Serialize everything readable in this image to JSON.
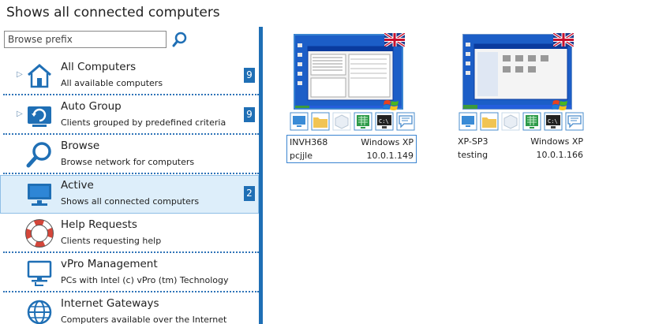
{
  "title": "Shows all connected computers",
  "search": {
    "placeholder": "Browse prefix"
  },
  "sidebar": {
    "items": [
      {
        "name": "All Computers",
        "desc": "All available computers",
        "badge": "9",
        "expandable": true,
        "icon": "house-icon"
      },
      {
        "name": "Auto Group",
        "desc": "Clients grouped by predefined criteria",
        "badge": "9",
        "expandable": true,
        "icon": "refresh-icon"
      },
      {
        "name": "Browse",
        "desc": "Browse network for computers",
        "icon": "magnifier-icon"
      },
      {
        "name": "Active",
        "desc": "Shows all connected computers",
        "badge": "2",
        "selected": true,
        "icon": "monitor-icon"
      },
      {
        "name": "Help Requests",
        "desc": "Clients requesting help",
        "icon": "lifebuoy-icon"
      },
      {
        "name": "vPro Management",
        "desc": "PCs with Intel (c) vPro (tm) Technology",
        "icon": "vpro-monitor-icon"
      },
      {
        "name": "Internet Gateways",
        "desc": "Computers available over the Internet",
        "icon": "globe-icon"
      }
    ]
  },
  "computers": [
    {
      "name": "INVH368",
      "os": "Windows XP",
      "user": "pcjjle",
      "ip": "10.0.1.149",
      "selected": true,
      "flag": "uk-flag-icon"
    },
    {
      "name": "XP-SP3",
      "os": "Windows XP",
      "user": "testing",
      "ip": "10.0.1.166",
      "selected": false,
      "flag": "uk-flag-icon"
    }
  ],
  "colors": {
    "accent": "#1f6fb5",
    "selected_bg": "#ddeefa",
    "separator": "#2f74b8"
  }
}
